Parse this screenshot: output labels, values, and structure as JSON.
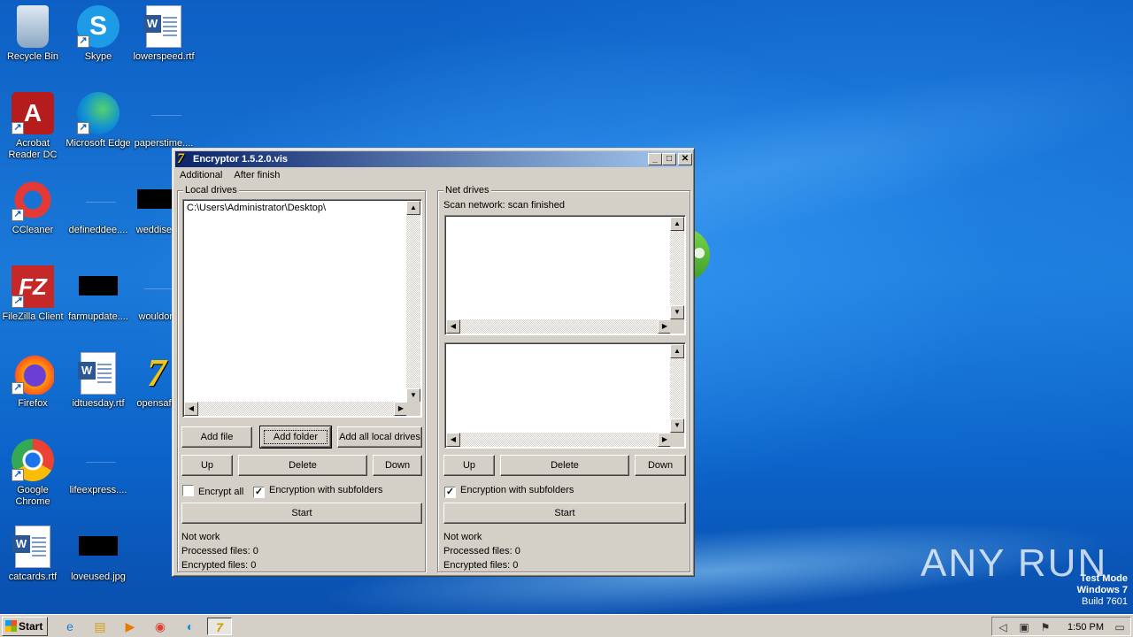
{
  "desktop": {
    "icons": [
      {
        "label": "Recycle Bin",
        "icon": "recycle-bin-icon"
      },
      {
        "label": "Skype",
        "icon": "skype-icon"
      },
      {
        "label": "lowerspeed.rtf",
        "icon": "word-document-icon"
      },
      {
        "label": "Acrobat Reader DC",
        "icon": "acrobat-icon"
      },
      {
        "label": "Microsoft Edge",
        "icon": "edge-icon"
      },
      {
        "label": "paperstime....",
        "icon": "file-icon"
      },
      {
        "label": "CCleaner",
        "icon": "ccleaner-icon"
      },
      {
        "label": "defineddee....",
        "icon": "file-icon"
      },
      {
        "label": "weddisea",
        "icon": "file-icon"
      },
      {
        "label": "FileZilla Client",
        "icon": "filezilla-icon"
      },
      {
        "label": "farmupdate....",
        "icon": "file-icon"
      },
      {
        "label": "wouldon",
        "icon": "file-icon"
      },
      {
        "label": "Firefox",
        "icon": "firefox-icon"
      },
      {
        "label": "idtuesday.rtf",
        "icon": "word-document-icon"
      },
      {
        "label": "opensafe",
        "icon": "7zip-icon"
      },
      {
        "label": "Google Chrome",
        "icon": "chrome-icon"
      },
      {
        "label": "lifeexpress....",
        "icon": "file-icon"
      },
      {
        "label": "catcards.rtf",
        "icon": "word-document-icon"
      },
      {
        "label": "loveused.jpg",
        "icon": "image-icon"
      }
    ],
    "watermark": {
      "line1": "Test Mode",
      "line2": "Windows 7",
      "line3": "Build 7601"
    },
    "brand": "ANY RUN"
  },
  "window": {
    "title": "Encryptor 1.5.2.0.vis",
    "buttons": {
      "minimize": "_",
      "maximize": "□",
      "close": "✕"
    },
    "menu": [
      "Additional",
      "After finish"
    ],
    "local": {
      "group_label": "Local drives",
      "list_items": [
        "C:\\Users\\Administrator\\Desktop\\"
      ],
      "add_file": "Add file",
      "add_folder": "Add folder",
      "add_all_local_drives": "Add all local drives",
      "up": "Up",
      "delete": "Delete",
      "down": "Down",
      "encrypt_all": {
        "label": "Encrypt all",
        "checked": false
      },
      "with_subfolders": {
        "label": "Encryption with subfolders",
        "checked": true
      },
      "start": "Start",
      "status": "Not work",
      "processed": "Processed files: 0",
      "encrypted": "Encrypted files: 0"
    },
    "net": {
      "group_label": "Net drives",
      "scan_status": "Scan network: scan finished",
      "up": "Up",
      "delete": "Delete",
      "down": "Down",
      "with_subfolders": {
        "label": "Encryption with subfolders",
        "checked": true
      },
      "start": "Start",
      "status": "Not work",
      "processed": "Processed files: 0",
      "encrypted": "Encrypted files: 0"
    }
  },
  "taskbar": {
    "start_label": "Start",
    "clock": "1:50 PM",
    "pinned": [
      "internet-explorer-icon",
      "explorer-icon",
      "media-player-icon",
      "chrome-icon",
      "edge-icon",
      "encryptor-icon"
    ]
  },
  "colors": {
    "title_gradient_start": "#0a246a",
    "title_gradient_end": "#a6caf0",
    "window_face": "#d4d0c8",
    "desktop_blue": "#1166c9"
  }
}
